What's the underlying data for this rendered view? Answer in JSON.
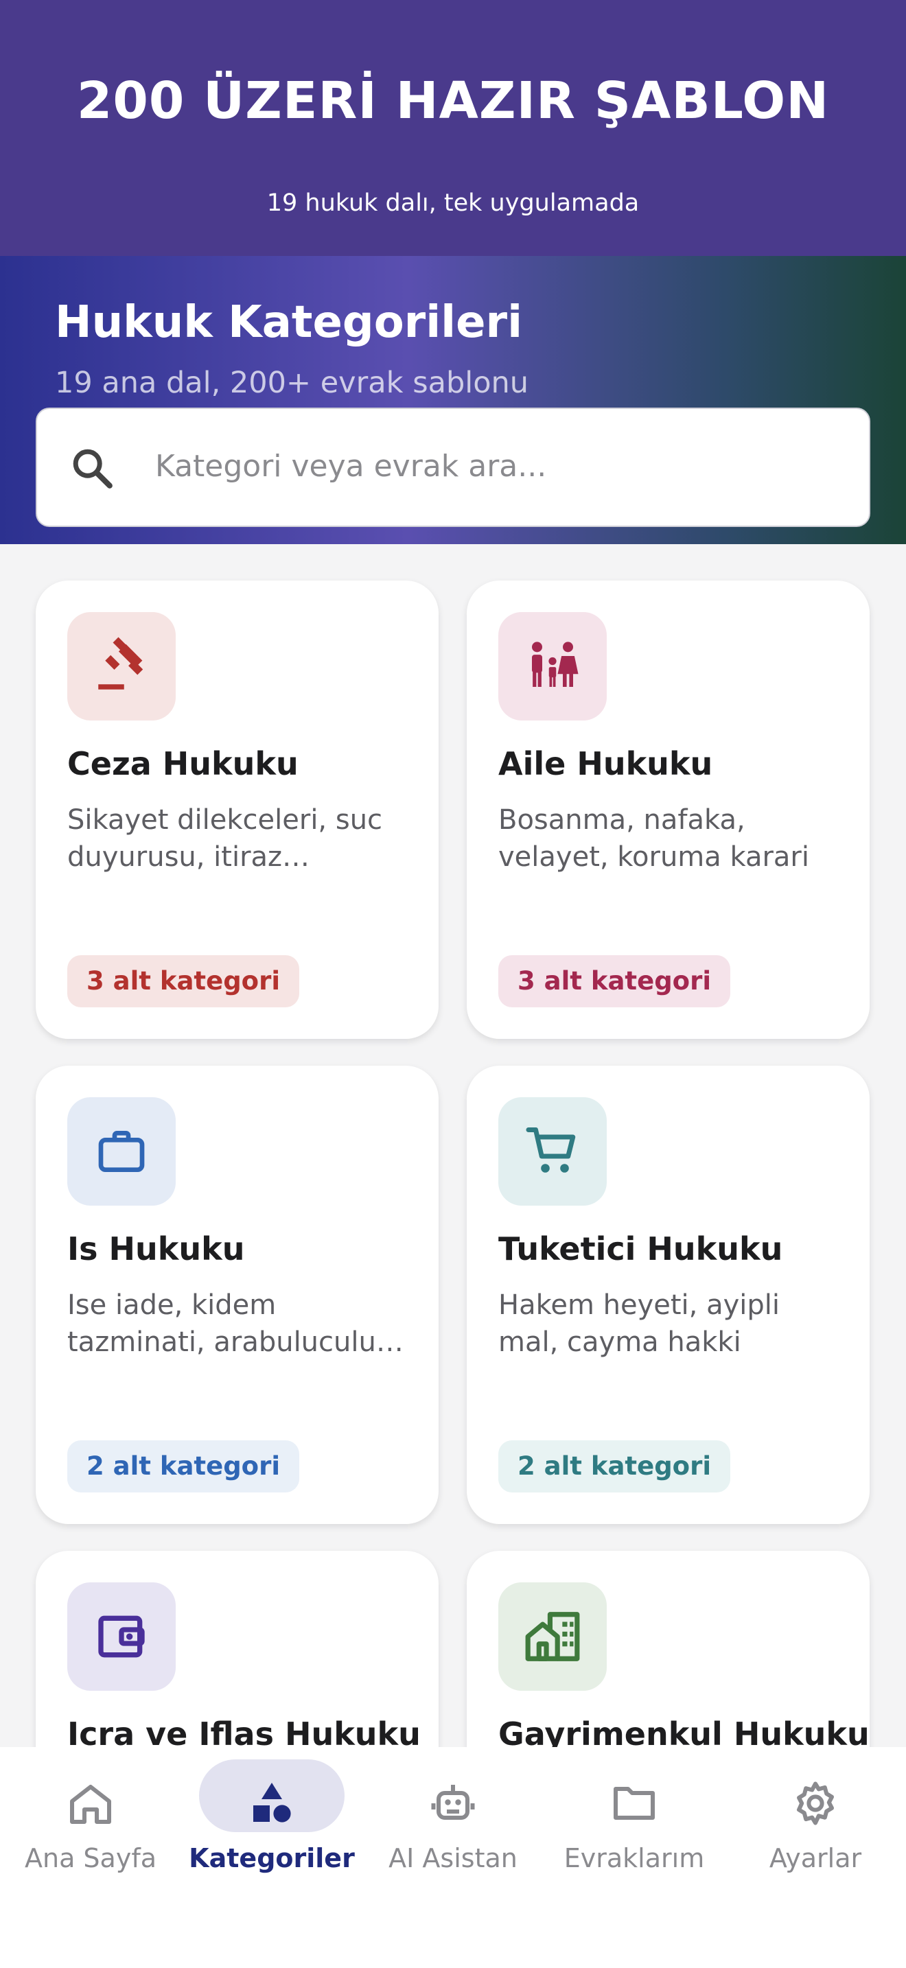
{
  "promo": {
    "title": "200 ÜZERİ HAZIR ŞABLON",
    "subtitle": "19 hukuk dalı, tek uygulamada"
  },
  "header": {
    "title": "Hukuk Kategorileri",
    "subtitle": "19 ana dal, 200+ evrak sablonu"
  },
  "search": {
    "placeholder": "Kategori veya evrak ara...",
    "icon": "search-icon"
  },
  "categories": [
    {
      "title": "Ceza Hukuku",
      "description": "Sikayet dilekceleri, suc duyurusu, itiraz dilekceleri",
      "tag": "3 alt kategori",
      "icon": "gavel-icon",
      "color": "#b3322e",
      "bg": "#f6e4e3"
    },
    {
      "title": "Aile Hukuku",
      "description": "Bosanma, nafaka, velayet, koruma karari",
      "tag": "3 alt kategori",
      "icon": "family-icon",
      "color": "#a3284f",
      "bg": "#f5e3ea"
    },
    {
      "title": "Is Hukuku",
      "description": "Ise iade, kidem tazminati, arabuluculuk basvurusu",
      "tag": "2 alt kategori",
      "icon": "briefcase-icon",
      "color": "#2f66b5",
      "bg": "#e4ebf6"
    },
    {
      "title": "Tuketici Hukuku",
      "description": "Hakem heyeti, ayipli mal, cayma hakki",
      "tag": "2 alt kategori",
      "icon": "cart-icon",
      "color": "#2f7b82",
      "bg": "#e2eff0"
    },
    {
      "title": "Icra ve Iflas Hukuku",
      "description": "",
      "tag": "",
      "icon": "wallet-icon",
      "color": "#4a2f9a",
      "bg": "#e7e4f3"
    },
    {
      "title": "Gayrimenkul Hukuku",
      "description": "",
      "tag": "",
      "icon": "building-icon",
      "color": "#3f7a3c",
      "bg": "#e6efe5"
    }
  ],
  "nav": {
    "items": [
      {
        "label": "Ana Sayfa",
        "icon": "home-icon"
      },
      {
        "label": "Kategoriler",
        "icon": "categories-icon",
        "active": true
      },
      {
        "label": "AI Asistan",
        "icon": "robot-icon"
      },
      {
        "label": "Evraklarım",
        "icon": "folder-icon"
      },
      {
        "label": "Ayarlar",
        "icon": "gear-icon"
      }
    ]
  }
}
